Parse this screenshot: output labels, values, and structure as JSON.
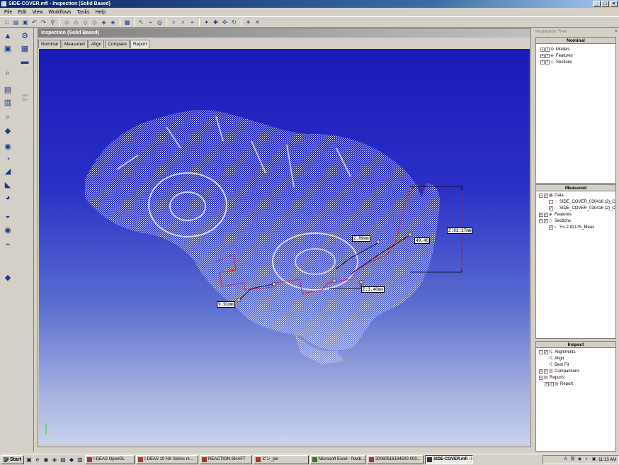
{
  "window": {
    "title": "SIDE-COVER.mfi - Inspection (Solid Based)",
    "minimize": "_",
    "maximize": "□",
    "close": "×"
  },
  "menu": [
    "File",
    "Edit",
    "View",
    "Workflows",
    "Tasks",
    "Help"
  ],
  "toolbar": {
    "icons": [
      "new-icon",
      "open-icon",
      "save-icon",
      "undo-icon",
      "redo-icon",
      "wizard-icon",
      "sep",
      "box-icon",
      "box-icon",
      "box-icon",
      "box-icon",
      "box-icon",
      "box-icon",
      "sep",
      "grid-icon",
      "sep",
      "pointer-icon",
      "lasso-icon",
      "sphere-icon",
      "sep",
      "zoom-icon",
      "zoom-window-icon",
      "zoom-fit-icon",
      "sep",
      "rotate-icon",
      "fit-icon",
      "pan-icon",
      "rotate-free-icon",
      "sep",
      "light-icon",
      "close-view-icon"
    ],
    "glyphs": [
      "□",
      "▤",
      "▣",
      "↶",
      "↷",
      "⚲",
      "|",
      "◇",
      "◇",
      "◇",
      "◇",
      "◈",
      "◈",
      "|",
      "▦",
      "|",
      "↖",
      "⌁",
      "◎",
      "|",
      "⌕",
      "⌕",
      "⌖",
      "|",
      "✦",
      "✚",
      "✣",
      "↻",
      "|",
      "☀",
      "✕"
    ]
  },
  "left_tools": {
    "expdev_label": "exp dev",
    "icons": [
      "▲",
      "⚙",
      "▣",
      "▦",
      "⌕",
      "▤",
      "▥",
      "⌕",
      "▬",
      "◆",
      "◉",
      "◔",
      "◢",
      "◣",
      "◕",
      "◒",
      "◉",
      "⌁",
      "◆"
    ]
  },
  "document": {
    "title": "Inspection (Solid Based)",
    "tabs": [
      "Nominal",
      "Measured",
      "Align",
      "Compare",
      "Report"
    ],
    "active_tab": "Report",
    "view_label": "Ortho",
    "measurements": [
      "Z:91.17mm",
      "2.89mm",
      "49.46",
      "Z:3.40mm",
      "9.91mm"
    ]
  },
  "inspection_tree": {
    "title": "Inspection Tree",
    "close": "×",
    "nominal": {
      "header": "Nominal",
      "items": [
        "Models",
        "Features",
        "Sections"
      ]
    },
    "measured": {
      "header": "Measured",
      "items": [
        "Data",
        "SIDE_COVER_030416 (2)_C",
        "SIDE_COVER_030416 (2)_C",
        "Features",
        "Sections",
        "Y=-2.92175_Meas"
      ]
    },
    "inspect": {
      "header": "Inspect",
      "items": [
        "Alignments",
        "Align",
        "Best Fit",
        "Comparisons",
        "Reports",
        "Report"
      ]
    }
  },
  "taskbar": {
    "start": "Start",
    "buttons": [
      "I-DEAS OpenGL",
      "I-DEAS 10 NX Series m...",
      "REACTION-SHAFT",
      "ピン_pin",
      "Microsoft Excel - flowb...",
      "20060516184500-000...",
      "SIDE-COVER.mfi - In..."
    ],
    "active_button": "SIDE-COVER.mfi - In...",
    "clock": "11:13 AM"
  },
  "colors": {
    "viewport_top": "#1a1ab8",
    "viewport_bottom": "#c8d0ec",
    "section_line": "#e02020",
    "measurement_line": "#000000"
  }
}
